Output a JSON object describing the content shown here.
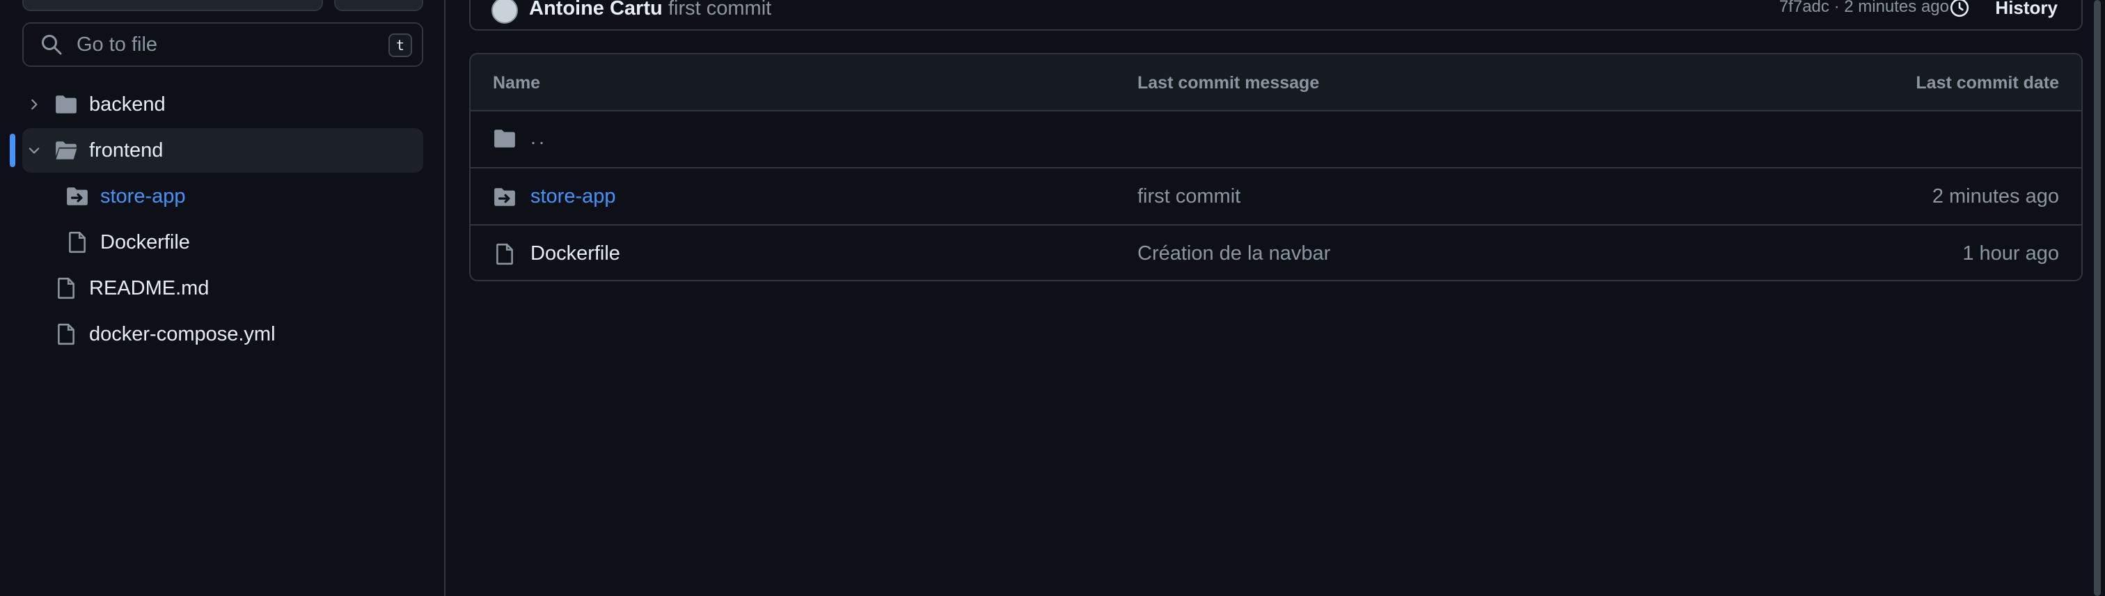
{
  "sidebar": {
    "search": {
      "placeholder": "Go to file",
      "shortcut_key": "t"
    },
    "tree": [
      {
        "label": "backend",
        "type": "folder",
        "expanded": false
      },
      {
        "label": "frontend",
        "type": "folder",
        "expanded": true,
        "selected": true
      },
      {
        "label": "store-app",
        "type": "submodule",
        "parent": "frontend",
        "link": true
      },
      {
        "label": "Dockerfile",
        "type": "file",
        "parent": "frontend"
      },
      {
        "label": "README.md",
        "type": "file"
      },
      {
        "label": "docker-compose.yml",
        "type": "file"
      }
    ]
  },
  "commit_bar": {
    "author": "Antoine Cartu",
    "message": "first commit",
    "sha_and_time": "7f7adc · 2 minutes ago",
    "history_label": "History"
  },
  "files_table": {
    "headers": {
      "name": "Name",
      "message": "Last commit message",
      "date": "Last commit date"
    },
    "parent_dir_label": "..",
    "rows": [
      {
        "name": "store-app",
        "type": "submodule",
        "message": "first commit",
        "date": "2 minutes ago"
      },
      {
        "name": "Dockerfile",
        "type": "file",
        "message": "Création de la navbar",
        "date": "1 hour ago"
      }
    ]
  },
  "colors": {
    "background": "#0d1117",
    "border": "#30363d",
    "text": "#e6edf3",
    "muted": "#8d96a0",
    "accent": "#4493f8",
    "folder_icon": "#8d96a0"
  },
  "icons": {
    "search": "search-icon",
    "folder": "folder-icon",
    "submodule": "submodule-folder-icon",
    "file": "file-icon",
    "chevron_right": "chevron-right-icon",
    "chevron_down": "chevron-down-icon",
    "history": "history-icon"
  }
}
